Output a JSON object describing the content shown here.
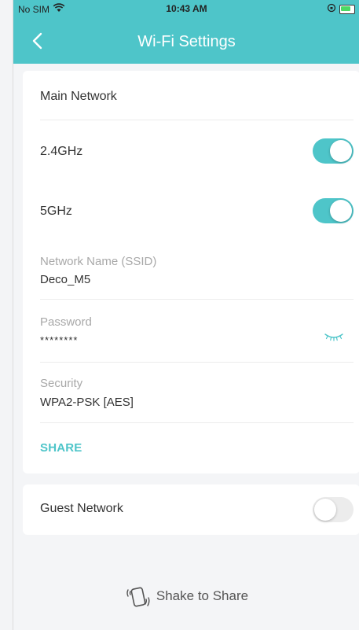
{
  "status_bar": {
    "carrier": "No SIM",
    "time": "10:43 AM",
    "icons": [
      "wifi-icon",
      "orientation-lock-icon",
      "battery-icon"
    ]
  },
  "header": {
    "title": "Wi-Fi Settings",
    "back_icon": "chevron-left-icon",
    "color": "#4ec5c9"
  },
  "main_network": {
    "heading": "Main Network",
    "bands": [
      {
        "label": "2.4GHz",
        "enabled": true
      },
      {
        "label": "5GHz",
        "enabled": true
      }
    ],
    "ssid": {
      "label": "Network Name (SSID)",
      "value": "Deco_M5"
    },
    "password": {
      "label": "Password",
      "value": "********",
      "icon": "eye-closed-icon"
    },
    "security": {
      "label": "Security",
      "value": "WPA2-PSK [AES]"
    },
    "share_label": "SHARE"
  },
  "guest_network": {
    "label": "Guest Network",
    "enabled": false
  },
  "shake": {
    "label": "Shake to Share",
    "icon": "shake-phone-icon"
  },
  "colors": {
    "accent": "#4ec5c9",
    "text": "#333333",
    "muted": "#a8a8a8"
  }
}
